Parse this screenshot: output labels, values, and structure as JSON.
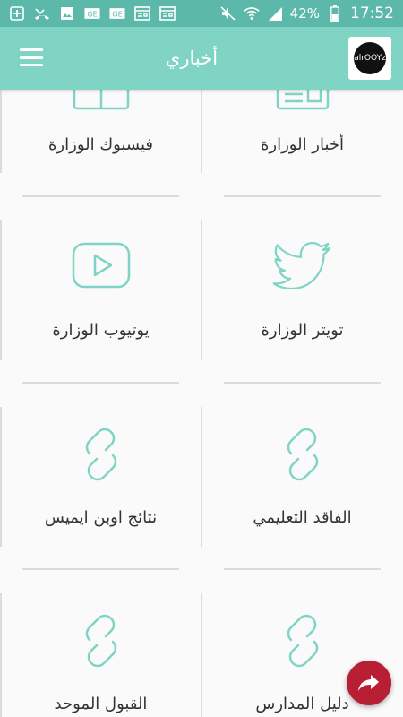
{
  "status_bar": {
    "battery": "42%",
    "time": "17:52"
  },
  "app_bar": {
    "title": "أخباري",
    "logo_text": "alrOOYz"
  },
  "tiles": [
    {
      "label": "أخبار الوزارة",
      "icon": "newspaper-icon"
    },
    {
      "label": "فيسبوك الوزارة",
      "icon": "grid-icon"
    },
    {
      "label": "تويتر الوزارة",
      "icon": "twitter-bird-icon"
    },
    {
      "label": "يوتيوب الوزارة",
      "icon": "youtube-play-icon"
    },
    {
      "label": "الفاقد التعليمي",
      "icon": "link-icon"
    },
    {
      "label": "نتائج اوبن ايميس",
      "icon": "link-icon"
    },
    {
      "label": "دليل المدارس",
      "icon": "link-icon"
    },
    {
      "label": "القبول الموحد",
      "icon": "link-icon"
    }
  ],
  "colors": {
    "status_bar": "#5cb8a8",
    "app_bar": "#7fd4c4",
    "icon_stroke": "#7fd4c4",
    "fab": "#b81f35"
  }
}
